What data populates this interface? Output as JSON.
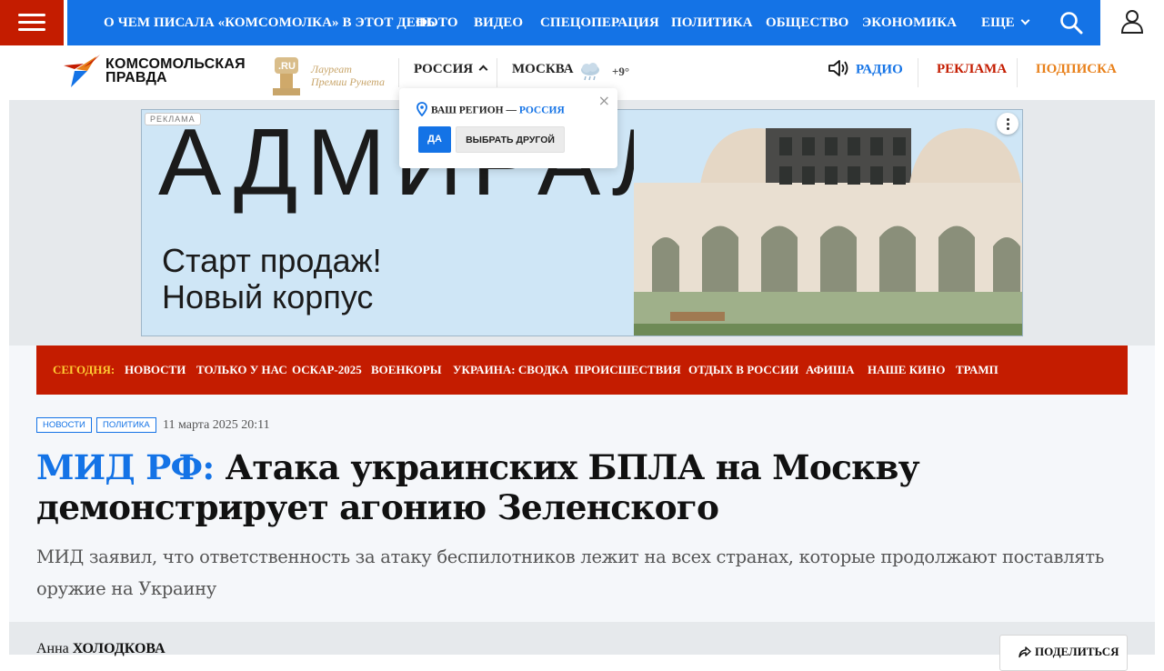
{
  "topnav": {
    "items": [
      "О ЧЕМ ПИСАЛА «КОМСОМОЛКА» В ЭТОТ ДЕНЬ",
      "ФОТО",
      "ВИДЕО",
      "СПЕЦОПЕРАЦИЯ",
      "ПОЛИТИКА",
      "ОБЩЕСТВО",
      "ЭКОНОМИКА"
    ],
    "more_label": "ЕЩЕ"
  },
  "header": {
    "logo_line1": "КОМСОМОЛЬСКАЯ",
    "logo_line2": "ПРАВДА",
    "award_line1": "Лауреат",
    "award_line2": "Премии Рунета",
    "award_badge": ".RU",
    "region": "РОССИЯ",
    "city": "МОСКВА",
    "temperature": "+9°",
    "radio": "РАДИО",
    "ads": "РЕКЛАМА",
    "subscribe": "ПОДПИСКА"
  },
  "region_popup": {
    "question": "ВАШ РЕГИОН —",
    "region": "РОССИЯ",
    "yes": "ДА",
    "other": "ВЫБРАТЬ ДРУГОЙ",
    "close": "×"
  },
  "ad": {
    "badge": "РЕКЛАМА",
    "brand": "АДМИРАЛ",
    "slogan_line1": "Старт продаж!",
    "slogan_line2": "Новый корпус"
  },
  "today": {
    "label": "СЕГОДНЯ:",
    "links": [
      "НОВОСТИ",
      "ТОЛЬКО У НАС",
      "ОСКАР-2025",
      "ВОЕНКОРЫ",
      "УКРАИНА: СВОДКА",
      "ПРОИСШЕСТВИЯ",
      "ОТДЫХ В РОССИИ",
      "АФИША",
      "НАШЕ КИНО",
      "ТРАМП"
    ]
  },
  "article": {
    "tags": [
      "НОВОСТИ",
      "ПОЛИТИКА"
    ],
    "date": "11 марта 2025 20:11",
    "headline_prefix": "МИД РФ:",
    "headline": "Атака украинских БПЛА на Москву демонстрирует агонию Зеленского",
    "lead": "МИД заявил, что ответственность за атаку беспилотников лежит на всех странах, которые продолжают поставлять оружие на Украину",
    "author_first": "Анна",
    "author_last": "ХОЛОДКОВА",
    "share": "ПОДЕЛИТЬСЯ"
  },
  "colors": {
    "brand_red": "#c41c00",
    "brand_blue": "#1473e6",
    "accent_orange": "#e8801a",
    "today_yellow": "#ffcc33"
  },
  "icons": [
    "menu-icon",
    "search-icon",
    "user-icon",
    "weather-icon",
    "speaker-icon",
    "location-pin-icon",
    "share-icon",
    "more-options-icon"
  ]
}
